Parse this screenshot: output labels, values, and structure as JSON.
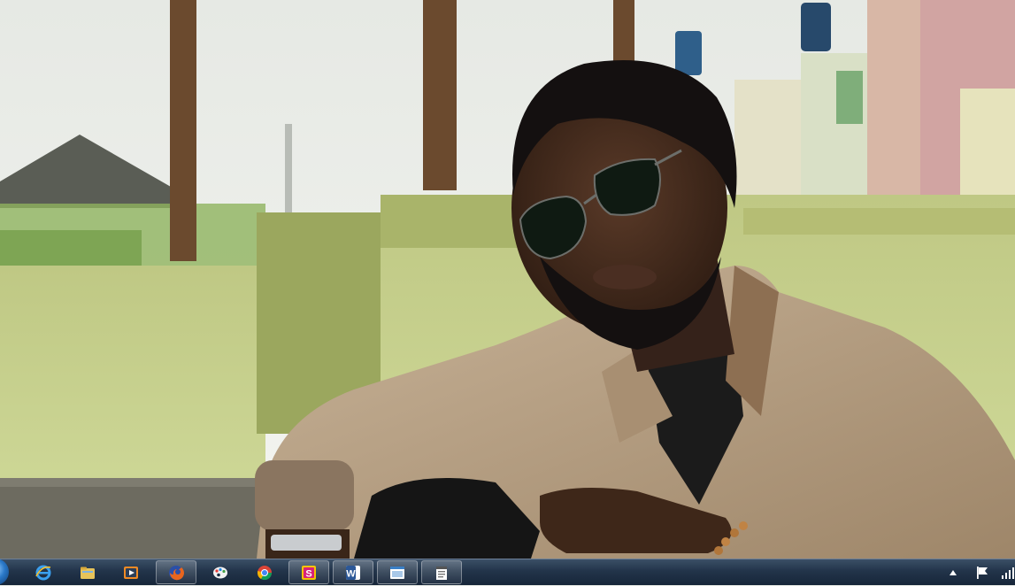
{
  "desktop": {
    "wallpaper": "portrait-photo",
    "colors": {
      "wall": "#c9d48e",
      "jacket": "#b49c80",
      "shirt": "#1b1b1b",
      "sky": "#eef0ec"
    }
  },
  "taskbar": {
    "pinned": [
      {
        "id": "ie",
        "icon": "internet-explorer-icon",
        "running": false
      },
      {
        "id": "explorer",
        "icon": "file-explorer-folder-icon",
        "running": false
      },
      {
        "id": "media",
        "icon": "media-player-icon",
        "running": false
      },
      {
        "id": "firefox",
        "icon": "firefox-icon",
        "running": true
      },
      {
        "id": "paint",
        "icon": "paint-palette-icon",
        "running": false
      },
      {
        "id": "chrome",
        "icon": "chrome-icon",
        "running": false
      },
      {
        "id": "app-s",
        "icon": "app-s-icon",
        "letter": "S",
        "running": true
      },
      {
        "id": "word",
        "icon": "word-icon",
        "letter": "W",
        "running": true
      },
      {
        "id": "window",
        "icon": "window-app-icon",
        "running": true
      },
      {
        "id": "notes",
        "icon": "notes-app-icon",
        "running": true
      }
    ],
    "tray": {
      "icons": [
        "show-hidden-icons-arrow",
        "action-center-flag-icon",
        "network-signal-icon"
      ]
    }
  }
}
